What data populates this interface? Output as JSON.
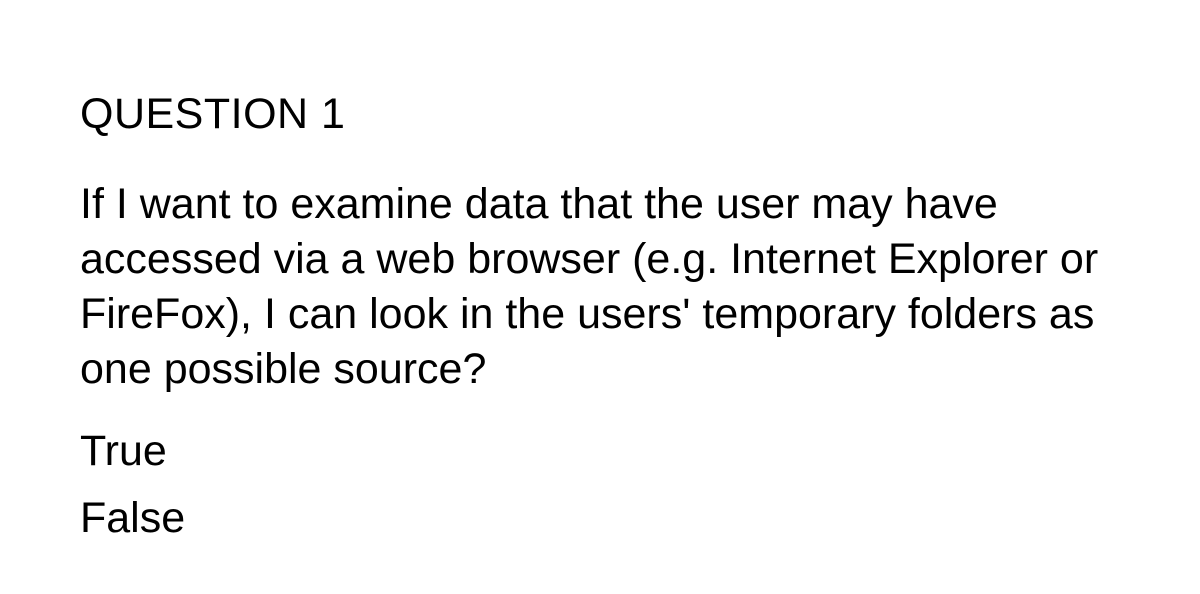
{
  "question": {
    "title": "QUESTION 1",
    "body": "If I want to examine data that the user may have accessed via a web browser (e.g. Internet Explorer or FireFox), I can look in the users' temporary folders as one possible source?",
    "options": [
      "True",
      "False"
    ]
  }
}
